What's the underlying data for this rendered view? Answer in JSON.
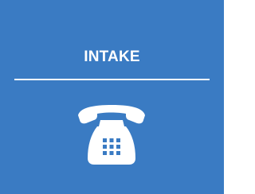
{
  "tile": {
    "title": "INTAKE",
    "icon": "telephone-icon",
    "background_color": "#3a7bc3",
    "foreground_color": "#ffffff"
  }
}
